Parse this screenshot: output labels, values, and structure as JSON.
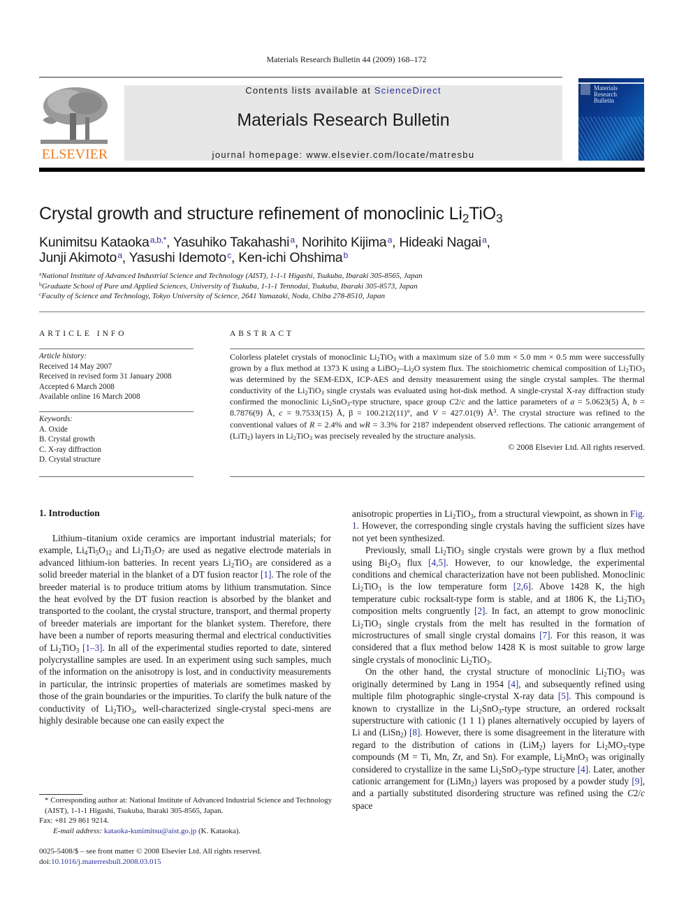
{
  "header": {
    "running_head": "Materials Research Bulletin 44 (2009) 168–172",
    "contents_prefix": "Contents lists available at ",
    "contents_link": "ScienceDirect",
    "journal_name": "Materials Research Bulletin",
    "homepage": "journal homepage: www.elsevier.com/locate/matresbu",
    "publisher_logo_text": "ELSEVIER",
    "cover_title_lines": [
      "Materials",
      "Research",
      "Bulletin"
    ],
    "colors": {
      "publisher_orange": "#f07c1e",
      "link_blue": "#2a2f9a",
      "banner_gray": "#e7e7e7",
      "cover_blue": "#0a3a8f"
    }
  },
  "article": {
    "title_main": "Crystal growth and structure refinement of monoclinic Li",
    "title_sub1": "2",
    "title_mid": "TiO",
    "title_sub2": "3",
    "authors": [
      {
        "name": "Kunimitsu Kataoka",
        "aff": "a,b,*",
        "sep": ", "
      },
      {
        "name": "Yasuhiko Takahashi",
        "aff": "a",
        "sep": ", "
      },
      {
        "name": "Norihito Kijima",
        "aff": "a",
        "sep": ", "
      },
      {
        "name": "Hideaki Nagai",
        "aff": "a",
        "sep": ","
      },
      {
        "name": "Junji Akimoto",
        "aff": "a",
        "sep": ", "
      },
      {
        "name": "Yasushi Idemoto",
        "aff": "c",
        "sep": ", "
      },
      {
        "name": "Ken-ichi Ohshima",
        "aff": "b",
        "sep": ""
      }
    ],
    "affiliations": [
      {
        "mark": "a",
        "text": "National Institute of Advanced Industrial Science and Technology (AIST), 1-1-1 Higashi, Tsukuba, Ibaraki 305-8565, Japan"
      },
      {
        "mark": "b",
        "text": "Graduate School of Pure and Applied Sciences, University of Tsukuba, 1-1-1 Tennodai, Tsukuba, Ibaraki 305-8573, Japan"
      },
      {
        "mark": "c",
        "text": "Faculty of Science and Technology, Tokyo University of Science, 2641 Yamazaki, Noda, Chiba 278-8510, Japan"
      }
    ]
  },
  "article_info": {
    "heading": "ARTICLE INFO",
    "history_label": "Article history:",
    "history": [
      "Received 14 May 2007",
      "Received in revised form 31 January 2008",
      "Accepted 6 March 2008",
      "Available online 16 March 2008"
    ],
    "keywords_label": "Keywords:",
    "keywords": [
      "A. Oxide",
      "B. Crystal growth",
      "C. X-ray diffraction",
      "D. Crystal structure"
    ]
  },
  "abstract": {
    "heading": "ABSTRACT",
    "copyright": "© 2008 Elsevier Ltd. All rights reserved."
  },
  "introduction": {
    "heading": "1.  Introduction",
    "refs": {
      "r1": "[1]",
      "r1_3": "[1–3]",
      "fig1": "Fig. 1",
      "r4_5": "[4,5]",
      "r2_6": "[2,6]",
      "r2": "[2]",
      "r7": "[7]",
      "r4": "[4]",
      "r5": "[5]",
      "r8": "[8]",
      "r9": "[9]"
    }
  },
  "footnote": {
    "corresponding": "* Corresponding author at: National Institute of Advanced Industrial Science and Technology (AIST), 1-1-1 Higashi, Tsukuba, Ibaraki 305-8565, Japan.",
    "fax": "Fax: +81 29 861 9214.",
    "email_label": "E-mail address:",
    "email": "kataoka-kunimitsu@aist.go.jp",
    "email_suffix": " (K. Kataoka).",
    "front_matter": "0025-5408/$ – see front matter © 2008 Elsevier Ltd. All rights reserved.",
    "doi_label": "doi:",
    "doi": "10.1016/j.materresbull.2008.03.015"
  }
}
